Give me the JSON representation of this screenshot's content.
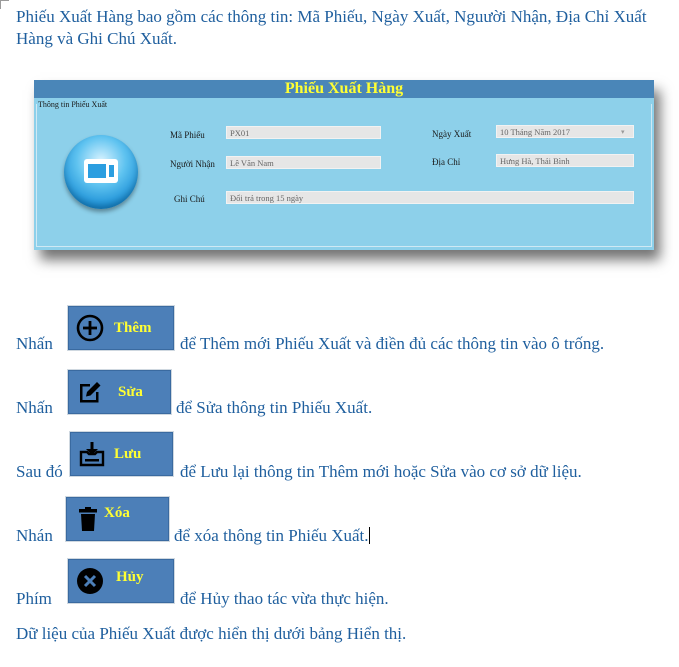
{
  "intro_text": "Phiếu Xuất Hàng bao gồm các thông tin: Mã Phiếu, Ngày Xuất, Nguười Nhận, Địa Chỉ Xuất Hàng và Ghi Chú Xuất.",
  "form": {
    "title": "Phiếu Xuất Hàng",
    "group_label": "Thông tin Phiếu Xuất",
    "fields": {
      "ma_phieu": {
        "label": "Mã Phiếu",
        "value": "PX01"
      },
      "nguoi_nhan": {
        "label": "Người Nhận",
        "value": "Lê Văn Nam"
      },
      "ghi_chu": {
        "label": "Ghi Chú",
        "value": "Đổi trả trong 15 ngày"
      },
      "ngay_xuat": {
        "label": "Ngày Xuất",
        "value": "10   Tháng Năm   2017"
      },
      "dia_chi": {
        "label": "Địa Chỉ",
        "value": "Hưng Hà, Thái Bình"
      }
    },
    "date_dropdown_glyph": "▾"
  },
  "instructions": [
    {
      "prefix": "Nhấn",
      "button_label": "Thêm",
      "icon": "plus-circle-icon",
      "suffix": "để Thêm mới Phiếu Xuất và điền đủ các thông tin vào ô trống."
    },
    {
      "prefix": "Nhấn",
      "button_label": "Sửa",
      "icon": "edit-icon",
      "suffix": "để Sửa thông tin Phiếu Xuất."
    },
    {
      "prefix": "Sau đó",
      "button_label": "Lưu",
      "icon": "save-download-icon",
      "suffix": "để Lưu lại thông tin Thêm mới hoặc Sửa vào cơ sở dữ liệu."
    },
    {
      "prefix": "Nhán",
      "button_label": "Xóa",
      "icon": "trash-icon",
      "suffix": "để xóa thông tin Phiếu Xuất."
    },
    {
      "prefix": "Phím",
      "button_label": "Hủy",
      "icon": "cancel-x-icon",
      "suffix": "để Hủy thao tác vừa thực hiện."
    }
  ],
  "footer_text": "Dữ liệu của Phiếu Xuất được hiển thị dưới bảng Hiển thị.",
  "colors": {
    "text": "#1f5f9e",
    "button_bg": "#4c7fb8",
    "button_text": "#ffff33",
    "form_bg": "#8dd0ea",
    "title_bar": "#4a86b8"
  }
}
